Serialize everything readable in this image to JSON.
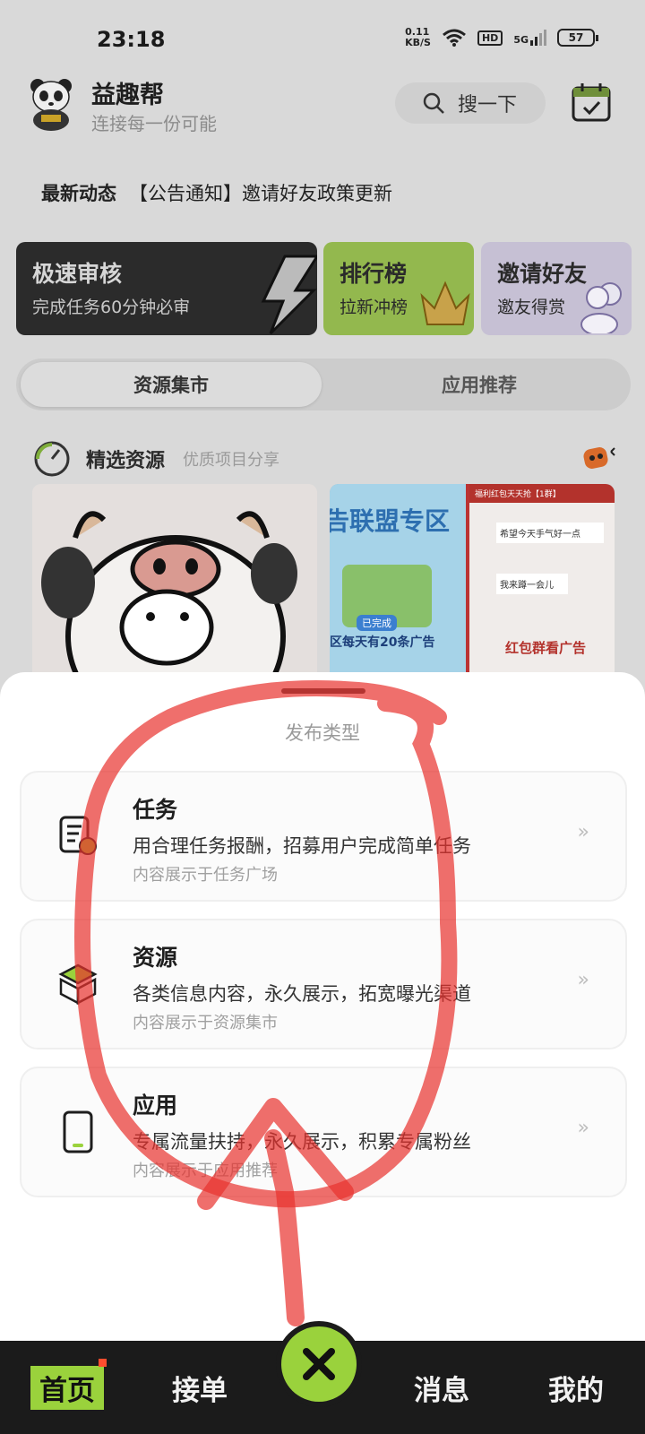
{
  "status_bar": {
    "time": "23:18",
    "net_speed_value": "0.11",
    "net_speed_unit": "KB/S",
    "hd": "HD",
    "signal": "5G",
    "battery": "57"
  },
  "header": {
    "app_name": "益趣帮",
    "slogan": "连接每一份可能",
    "search_label": "搜一下"
  },
  "news": {
    "tag": "最新动态",
    "text": "【公告通知】邀请好友政策更新"
  },
  "promo_cards": [
    {
      "title": "极速审核",
      "subtitle": "完成任务60分钟必审"
    },
    {
      "title": "排行榜",
      "subtitle": "拉新冲榜"
    },
    {
      "title": "邀请好友",
      "subtitle": "邀友得赏"
    }
  ],
  "tabs": [
    {
      "label": "资源集市",
      "active": true
    },
    {
      "label": "应用推荐",
      "active": false
    }
  ],
  "section": {
    "title": "精选资源",
    "subtitle": "优质项目分享"
  },
  "preview": {
    "banner_text": "告联盟专区",
    "banner_sub": "区每天有20条广告",
    "chat_header": "福利红包天天抢【1群】",
    "badge_done": "已完成",
    "chat_msgs": [
      "希望今天手气好一点",
      "我来蹲一会儿"
    ],
    "overlay_text": "红包群看广告"
  },
  "sheet": {
    "title": "发布类型",
    "items": [
      {
        "name": "任务",
        "desc": "用合理任务报酬，招募用户完成简单任务",
        "sub": "内容展示于任务广场",
        "icon": "task-doc-icon"
      },
      {
        "name": "资源",
        "desc": "各类信息内容，永久展示，拓宽曝光渠道",
        "sub": "内容展示于资源集市",
        "icon": "cube-box-icon"
      },
      {
        "name": "应用",
        "desc": "专属流量扶持，永久展示，积累专属粉丝",
        "sub": "内容展示于应用推荐",
        "icon": "phone-icon"
      }
    ]
  },
  "bottom_nav": {
    "home": "首页",
    "orders": "接单",
    "messages": "消息",
    "mine": "我的"
  },
  "colors": {
    "accent_green": "#9ad23c",
    "nav_bg": "#1b1b1b",
    "annotation_red": "#e8322e"
  }
}
